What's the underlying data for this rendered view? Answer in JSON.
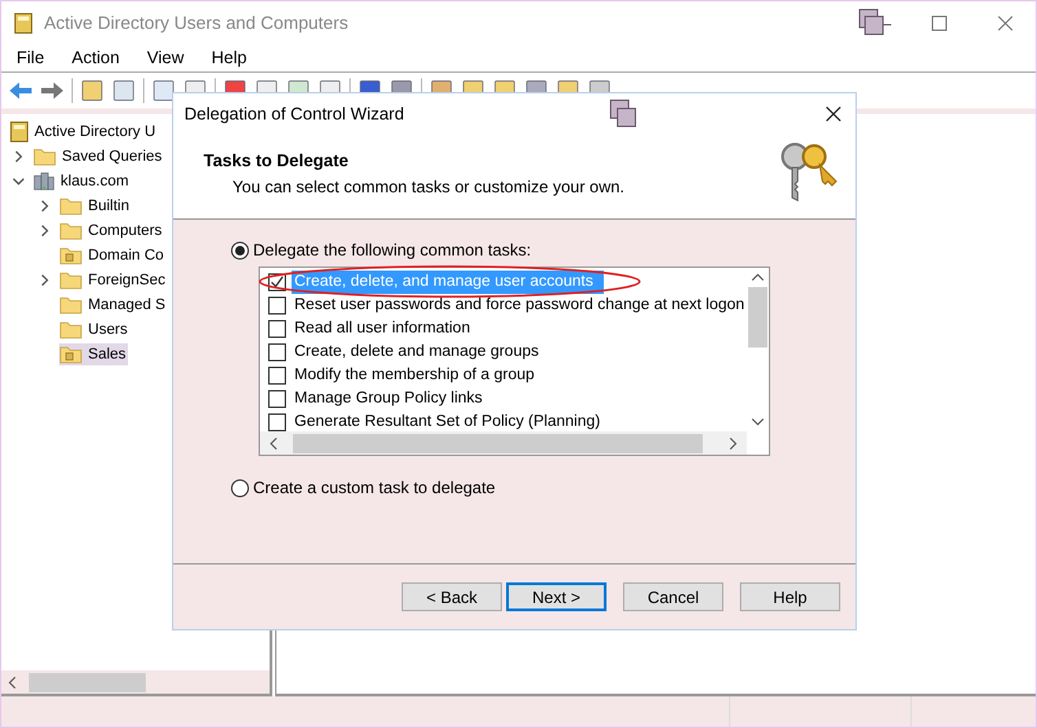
{
  "window": {
    "title": "Active Directory Users and Computers"
  },
  "menu": [
    "File",
    "Action",
    "View",
    "Help"
  ],
  "tree": [
    {
      "label": "Active Directory U",
      "kind": "root",
      "selected": false,
      "children": [
        {
          "label": "Saved Queries",
          "kind": "folder",
          "expanded": false,
          "selected": false
        },
        {
          "label": "klaus.com",
          "kind": "domain",
          "expanded": true,
          "selected": false,
          "children": [
            {
              "label": "Builtin",
              "kind": "folder",
              "expanded": false,
              "selected": false
            },
            {
              "label": "Computers",
              "kind": "folder",
              "expanded": false,
              "selected": false
            },
            {
              "label": "Domain Co",
              "kind": "ou",
              "selected": false
            },
            {
              "label": "ForeignSec",
              "kind": "folder",
              "expanded": false,
              "selected": false
            },
            {
              "label": "Managed S",
              "kind": "folder",
              "selected": false
            },
            {
              "label": "Users",
              "kind": "folder",
              "selected": false
            },
            {
              "label": "Sales",
              "kind": "ou",
              "selected": true
            }
          ]
        }
      ]
    }
  ],
  "dialog": {
    "title": "Delegation of Control Wizard",
    "heading": "Tasks to Delegate",
    "subtitle": "You can select common tasks or customize your own.",
    "options": [
      {
        "label": "Delegate the following common tasks:",
        "selected": true
      },
      {
        "label": "Create a custom task to delegate",
        "selected": false
      }
    ],
    "tasks": [
      {
        "label": "Create, delete, and manage user accounts",
        "checked": true,
        "selected": true,
        "circled": true
      },
      {
        "label": "Reset user passwords and force password change at next logon",
        "checked": false,
        "selected": false
      },
      {
        "label": "Read all user information",
        "checked": false,
        "selected": false
      },
      {
        "label": "Create, delete and manage groups",
        "checked": false,
        "selected": false
      },
      {
        "label": "Modify the membership of a group",
        "checked": false,
        "selected": false
      },
      {
        "label": "Manage Group Policy links",
        "checked": false,
        "selected": false
      },
      {
        "label": "Generate Resultant Set of Policy (Planning)",
        "checked": false,
        "selected": false
      }
    ],
    "buttons": [
      {
        "label": "< Back",
        "default": false
      },
      {
        "label": "Next >",
        "default": true
      },
      {
        "label": "Cancel",
        "default": false
      },
      {
        "label": "Help",
        "default": false
      }
    ]
  }
}
